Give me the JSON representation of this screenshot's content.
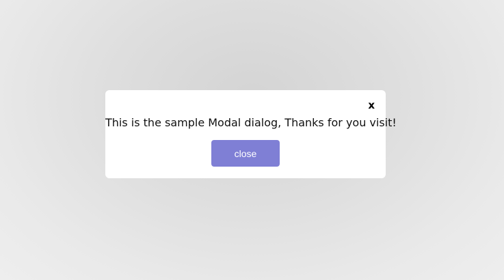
{
  "modal": {
    "close_icon_text": "x",
    "message": "This is the sample Modal dialog, Thanks for you visit!",
    "close_button_label": "close"
  },
  "colors": {
    "button_background": "#7f7fd5",
    "button_text": "#ffffff",
    "modal_background": "#ffffff"
  },
  "icons": {
    "close": "close-icon"
  }
}
